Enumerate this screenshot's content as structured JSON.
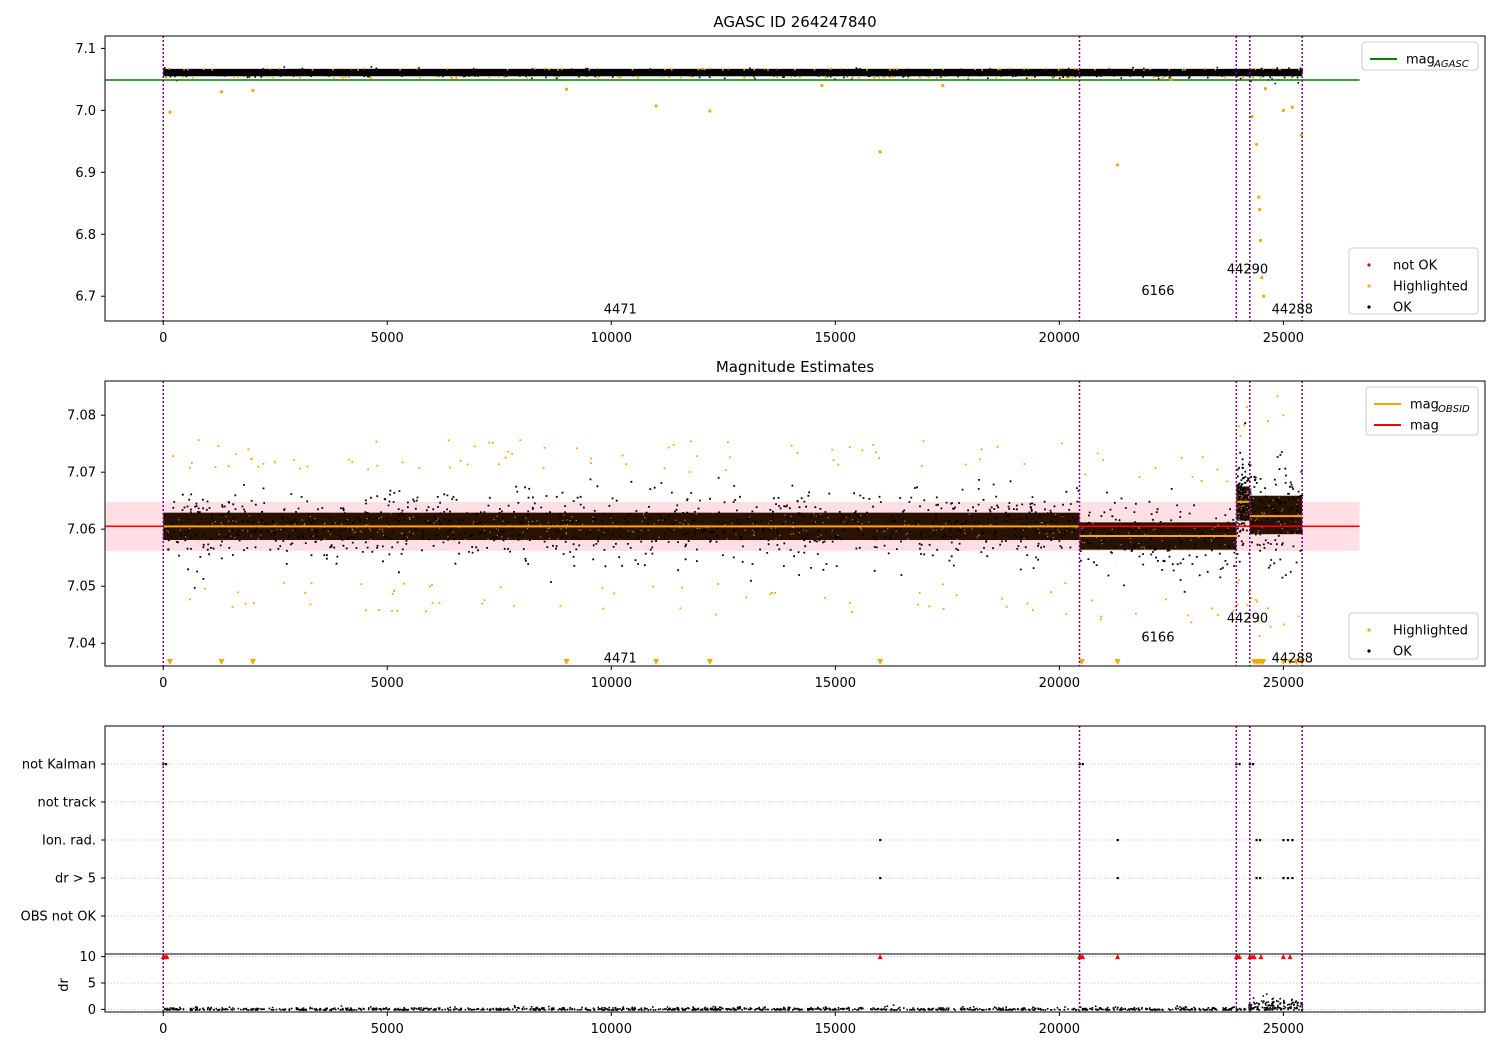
{
  "figure": {
    "x_range": [
      -1300,
      29500
    ],
    "x_ticks": [
      0,
      5000,
      10000,
      15000,
      20000,
      25000
    ],
    "obsid_boundaries": [
      0,
      20450,
      23950,
      24250,
      25420
    ],
    "colors": {
      "ok": "#000000",
      "highlighted": "#ffa500",
      "not_ok": "#ff0000",
      "agasc": "#008000",
      "mag": "#ff0000",
      "mag_obsid": "#ffa500",
      "boundary": "#800080",
      "band": "#ffc0cb"
    }
  },
  "chart_data": [
    {
      "type": "scatter",
      "title": "AGASC ID 264247840",
      "ylim": [
        6.66,
        7.12
      ],
      "y_ticks": [
        6.7,
        6.8,
        6.9,
        7.0,
        7.1
      ],
      "y_tick_labels": [
        "6.7",
        "6.8",
        "6.9",
        "7.0",
        "7.1"
      ],
      "series": [
        {
          "name": "not OK",
          "color": "#ff0000",
          "points": []
        },
        {
          "name": "Highlighted",
          "color": "#ffa500",
          "points": [
            [
              150,
              6.997
            ],
            [
              1300,
              7.03
            ],
            [
              2000,
              7.032
            ],
            [
              9000,
              7.034
            ],
            [
              11000,
              7.007
            ],
            [
              12200,
              6.999
            ],
            [
              14700,
              7.04
            ],
            [
              16000,
              6.933
            ],
            [
              17400,
              7.04
            ],
            [
              21300,
              6.912
            ],
            [
              22500,
              7.05
            ],
            [
              24300,
              6.99
            ],
            [
              24400,
              6.945
            ],
            [
              24450,
              6.86
            ],
            [
              24470,
              6.84
            ],
            [
              24490,
              6.79
            ],
            [
              24520,
              6.73
            ],
            [
              24560,
              6.7
            ],
            [
              24600,
              7.035
            ],
            [
              25000,
              7.0
            ],
            [
              25200,
              7.005
            ],
            [
              25400,
              6.96
            ]
          ]
        },
        {
          "name": "OK",
          "color": "#000000",
          "band": {
            "x": [
              0,
              25420
            ],
            "center": 7.061,
            "half_width": 0.006
          }
        }
      ],
      "lines": [
        {
          "name": "mag_AGASC",
          "color": "#008000",
          "x": [
            -1300,
            26700
          ],
          "y": 7.049
        }
      ],
      "obsid_labels": [
        {
          "text": "4471",
          "x": 10200,
          "y": 6.68
        },
        {
          "text": "6166",
          "x": 22200,
          "y": 6.71
        },
        {
          "text": "44290",
          "x": 24200,
          "y": 6.745
        },
        {
          "text": "44288",
          "x": 25200,
          "y": 6.68
        }
      ],
      "legends": [
        {
          "placement": "top-right",
          "entries": [
            {
              "label": "mag",
              "sub": "AGASC",
              "kind": "line",
              "color": "#008000"
            }
          ]
        },
        {
          "placement": "lower-right",
          "entries": [
            {
              "label": "not OK",
              "kind": "dot",
              "color": "#ff0000"
            },
            {
              "label": "Highlighted",
              "kind": "dot",
              "color": "#ffa500"
            },
            {
              "label": "OK",
              "kind": "dot",
              "color": "#000000"
            }
          ]
        }
      ]
    },
    {
      "type": "scatter",
      "title": "Magnitude Estimates",
      "ylim": [
        7.036,
        7.086
      ],
      "y_ticks": [
        7.04,
        7.05,
        7.06,
        7.07,
        7.08
      ],
      "y_tick_labels": [
        "7.04",
        "7.05",
        "7.06",
        "7.07",
        "7.08"
      ],
      "band": {
        "x": [
          -1300,
          26700
        ],
        "y": [
          7.0562,
          7.0648
        ]
      },
      "segments": [
        {
          "obsid": "4471",
          "x": [
            0,
            20450
          ],
          "center": 7.0605,
          "spread": 0.0032,
          "level": 7.0605
        },
        {
          "obsid": "6166",
          "x": [
            20450,
            23950
          ],
          "center": 7.0588,
          "spread": 0.0032,
          "level": 7.0588
        },
        {
          "obsid": "44290",
          "x": [
            23950,
            24250
          ],
          "center": 7.0645,
          "spread": 0.004,
          "level": 7.0648
        },
        {
          "obsid": "44288",
          "x": [
            24250,
            25420
          ],
          "center": 7.0625,
          "spread": 0.0045,
          "level": 7.0623
        }
      ],
      "highlighted_low_x": [
        150,
        1300,
        2000,
        9000,
        11000,
        12200,
        16000,
        20500,
        21300,
        24350,
        24400,
        24450,
        24500,
        24550,
        25000,
        25150,
        25300,
        25420
      ],
      "lines": [
        {
          "name": "mag",
          "color": "#ff0000",
          "x": [
            -1300,
            26700
          ],
          "y": 7.0605
        }
      ],
      "obsid_labels": [
        {
          "text": "4471",
          "x": 10200,
          "y": 7.0375
        },
        {
          "text": "6166",
          "x": 22200,
          "y": 7.0412
        },
        {
          "text": "44290",
          "x": 24200,
          "y": 7.0445
        },
        {
          "text": "44288",
          "x": 25200,
          "y": 7.0375
        }
      ],
      "legends": [
        {
          "placement": "top-right",
          "entries": [
            {
              "label": "mag",
              "sub": "OBSID",
              "kind": "line",
              "color": "#ffa500"
            },
            {
              "label": "mag",
              "kind": "line",
              "color": "#ff0000"
            }
          ]
        },
        {
          "placement": "lower-right",
          "entries": [
            {
              "label": "Highlighted",
              "kind": "dot",
              "color": "#ffa500"
            },
            {
              "label": "OK",
              "kind": "dot",
              "color": "#000000"
            }
          ]
        }
      ]
    },
    {
      "type": "scatter",
      "title": "",
      "flag_categories": [
        "not Kalman",
        "not track",
        "Ion. rad.",
        "dr > 5",
        "OBS not OK"
      ],
      "flag_points": [
        {
          "flag": "not Kalman",
          "x": [
            0,
            60,
            20450,
            20520,
            23950,
            24020,
            24250,
            24320
          ]
        },
        {
          "flag": "not track",
          "x": []
        },
        {
          "flag": "Ion. rad.",
          "x": [
            16000,
            21300,
            24400,
            24480,
            25000,
            25100,
            25200
          ]
        },
        {
          "flag": "dr > 5",
          "x": [
            16000,
            21300,
            24400,
            24480,
            25000,
            25100,
            25200
          ]
        },
        {
          "flag": "OBS not OK",
          "x": []
        }
      ]
    },
    {
      "type": "scatter",
      "title": "",
      "ylabel": "dr",
      "ylim": [
        -0.5,
        10.5
      ],
      "y_ticks": [
        0,
        5,
        10
      ],
      "y_tick_labels": [
        "0",
        "5",
        "10"
      ],
      "red_x": [
        0,
        40,
        80,
        16000,
        20450,
        20480,
        20520,
        21300,
        23950,
        23980,
        24020,
        24250,
        24300,
        24350,
        24500,
        25000,
        25150
      ],
      "red_y": 10,
      "bump_x": [
        24200,
        25400
      ]
    }
  ]
}
